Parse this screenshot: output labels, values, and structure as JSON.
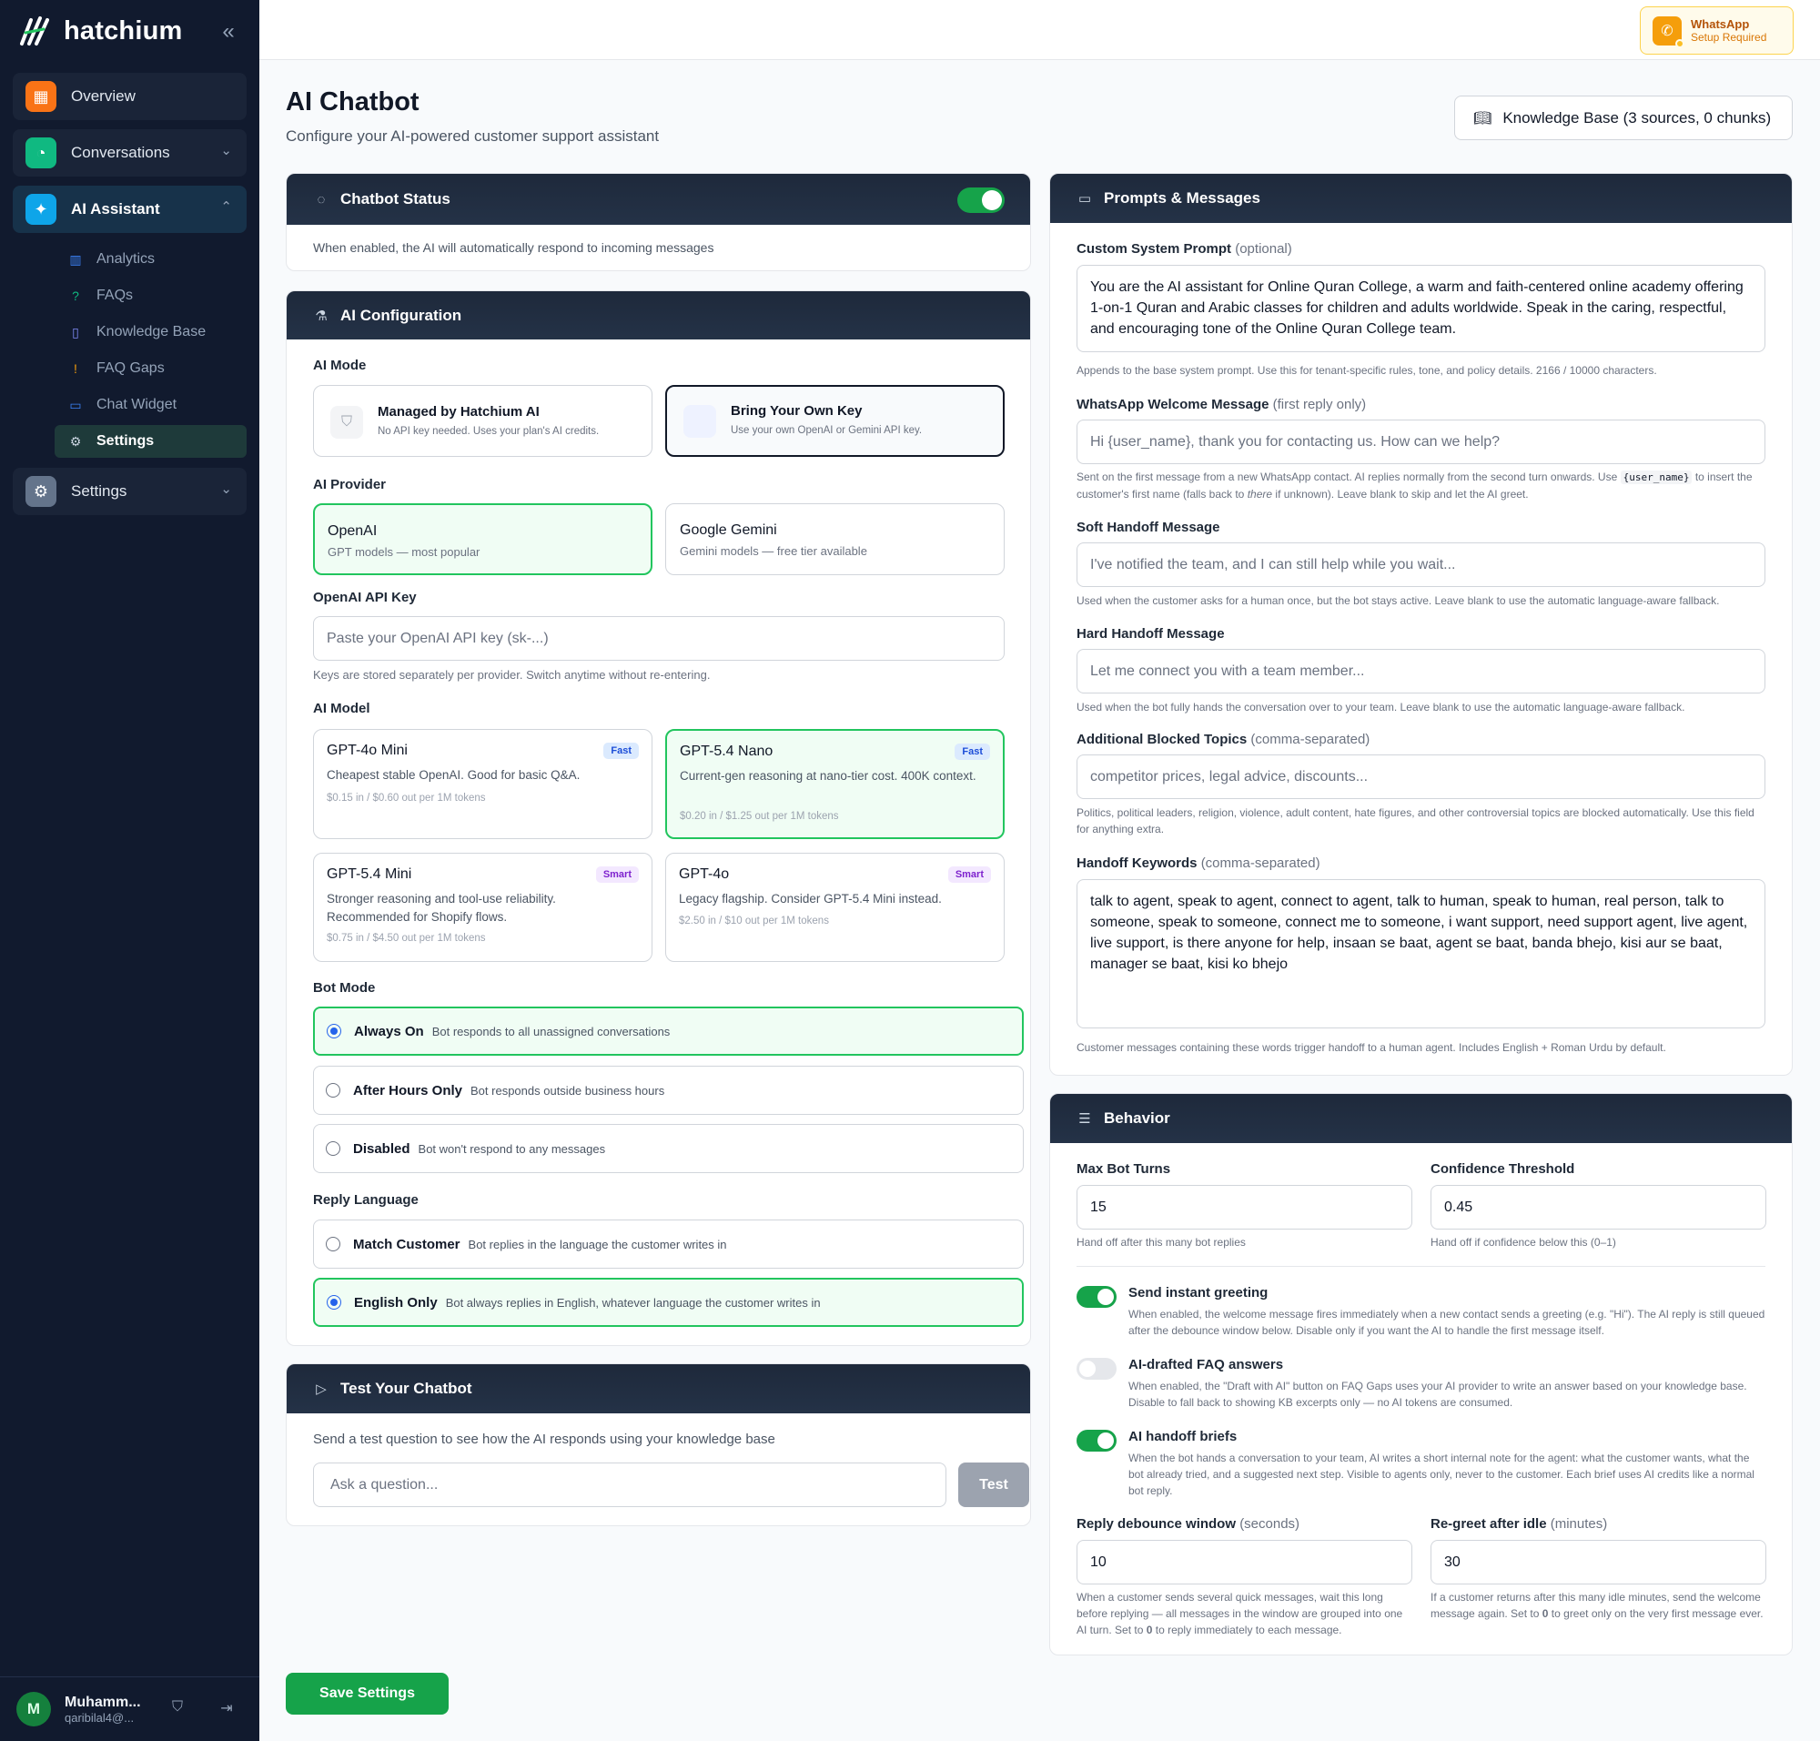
{
  "sidebar": {
    "brand": "hatchium",
    "nav": {
      "overview": "Overview",
      "conversations": "Conversations",
      "ai_assistant": "AI Assistant",
      "settings": "Settings"
    },
    "sub_items": {
      "analytics": "Analytics",
      "faqs": "FAQs",
      "knowledge_base": "Knowledge Base",
      "faq_gaps": "FAQ Gaps",
      "chat_widget": "Chat Widget",
      "settings": "Settings"
    },
    "user": {
      "initial": "M",
      "name": "Muhamm...",
      "email": "qaribilal4@..."
    }
  },
  "topbar": {
    "whatsapp_title": "WhatsApp",
    "whatsapp_sub": "Setup Required"
  },
  "page": {
    "title": "AI Chatbot",
    "subtitle": "Configure your AI-powered customer support assistant",
    "kb_button": "Knowledge Base (3 sources, 0 chunks)"
  },
  "status_card": {
    "title": "Chatbot Status",
    "enabled": true,
    "desc": "When enabled, the AI will automatically respond to incoming messages"
  },
  "config_card": {
    "title": "AI Configuration",
    "ai_mode_label": "AI Mode",
    "ai_modes": [
      {
        "title": "Managed by Hatchium AI",
        "desc": "No API key needed. Uses your plan's AI credits."
      },
      {
        "title": "Bring Your Own Key",
        "desc": "Use your own OpenAI or Gemini API key."
      }
    ],
    "provider_label": "AI Provider",
    "providers": [
      {
        "title": "OpenAI",
        "desc": "GPT models — most popular"
      },
      {
        "title": "Google Gemini",
        "desc": "Gemini models — free tier available"
      }
    ],
    "api_key_label": "OpenAI API Key",
    "api_key_placeholder": "Paste your OpenAI API key (sk-...)",
    "api_key_help": "Keys are stored separately per provider. Switch anytime without re-entering.",
    "model_label": "AI Model",
    "models": [
      {
        "title": "GPT-4o Mini",
        "badge": "Fast",
        "desc": "Cheapest stable OpenAI. Good for basic Q&A.",
        "price": "$0.15 in / $0.60 out per 1M tokens"
      },
      {
        "title": "GPT-5.4 Nano",
        "badge": "Fast",
        "desc": "Current-gen reasoning at nano-tier cost. 400K context.",
        "price": "$0.20 in / $1.25 out per 1M tokens"
      },
      {
        "title": "GPT-5.4 Mini",
        "badge": "Smart",
        "desc": "Stronger reasoning and tool-use reliability. Recommended for Shopify flows.",
        "price": "$0.75 in / $4.50 out per 1M tokens"
      },
      {
        "title": "GPT-4o",
        "badge": "Smart",
        "desc": "Legacy flagship. Consider GPT-5.4 Mini instead.",
        "price": "$2.50 in / $10 out per 1M tokens"
      }
    ],
    "bot_mode_label": "Bot Mode",
    "bot_modes": [
      {
        "title": "Always On",
        "desc": "Bot responds to all unassigned conversations"
      },
      {
        "title": "After Hours Only",
        "desc": "Bot responds outside business hours"
      },
      {
        "title": "Disabled",
        "desc": "Bot won't respond to any messages"
      }
    ],
    "reply_lang_label": "Reply Language",
    "reply_langs": [
      {
        "title": "Match Customer",
        "desc": "Bot replies in the language the customer writes in"
      },
      {
        "title": "English Only",
        "desc": "Bot always replies in English, whatever language the customer writes in"
      }
    ]
  },
  "test_card": {
    "title": "Test Your Chatbot",
    "desc": "Send a test question to see how the AI responds using your knowledge base",
    "placeholder": "Ask a question...",
    "button": "Test"
  },
  "prompts_card": {
    "title": "Prompts & Messages",
    "system_prompt_label": "Custom System Prompt",
    "system_prompt_opt": "(optional)",
    "system_prompt_value": "You are the AI assistant for Online Quran College, a warm and faith-centered online academy offering 1-on-1 Quran and Arabic classes for children and adults worldwide. Speak in the caring, respectful, and encouraging tone of the Online Quran College team.",
    "system_prompt_help": "Appends to the base system prompt. Use this for tenant-specific rules, tone, and policy details. 2166 / 10000 characters.",
    "welcome_label": "WhatsApp Welcome Message",
    "welcome_opt": "(first reply only)",
    "welcome_placeholder": "Hi {user_name}, thank you for contacting us. How can we help?",
    "welcome_help_1": "Sent on the first message from a new WhatsApp contact. AI replies normally from the second turn onwards. Use",
    "welcome_help_code": "{user_name}",
    "welcome_help_2": "to insert the customer's first name (falls back to",
    "welcome_help_em": "there",
    "welcome_help_3": "if unknown). Leave blank to skip and let the AI greet.",
    "soft_label": "Soft Handoff Message",
    "soft_placeholder": "I've notified the team, and I can still help while you wait...",
    "soft_help": "Used when the customer asks for a human once, but the bot stays active. Leave blank to use the automatic language-aware fallback.",
    "hard_label": "Hard Handoff Message",
    "hard_placeholder": "Let me connect you with a team member...",
    "hard_help": "Used when the bot fully hands the conversation over to your team. Leave blank to use the automatic language-aware fallback.",
    "blocked_label": "Additional Blocked Topics",
    "blocked_opt": "(comma-separated)",
    "blocked_placeholder": "competitor prices, legal advice, discounts...",
    "blocked_help": "Politics, political leaders, religion, violence, adult content, hate figures, and other controversial topics are blocked automatically. Use this field for anything extra.",
    "keywords_label": "Handoff Keywords",
    "keywords_opt": "(comma-separated)",
    "keywords_value": "talk to agent, speak to agent, connect to agent, talk to human, speak to human, real person, talk to someone, speak to someone, connect me to someone, i want support, need support agent, live agent, live support, is there anyone for help, insaan se baat, agent se baat, banda bhejo, kisi aur se baat, manager se baat, kisi ko bhejo",
    "keywords_help": "Customer messages containing these words trigger handoff to a human agent. Includes English + Roman Urdu by default."
  },
  "behavior_card": {
    "title": "Behavior",
    "max_turns_label": "Max Bot Turns",
    "max_turns_value": "15",
    "max_turns_help": "Hand off after this many bot replies",
    "confidence_label": "Confidence Threshold",
    "confidence_value": "0.45",
    "confidence_help": "Hand off if confidence below this (0–1)",
    "toggles": [
      {
        "title": "Send instant greeting",
        "on": true,
        "desc": "When enabled, the welcome message fires immediately when a new contact sends a greeting (e.g. \"Hi\"). The AI reply is still queued after the debounce window below. Disable only if you want the AI to handle the first message itself."
      },
      {
        "title": "AI-drafted FAQ answers",
        "on": false,
        "desc": "When enabled, the \"Draft with AI\" button on FAQ Gaps uses your AI provider to write an answer based on your knowledge base. Disable to fall back to showing KB excerpts only — no AI tokens are consumed."
      },
      {
        "title": "AI handoff briefs",
        "on": true,
        "desc": "When the bot hands a conversation to your team, AI writes a short internal note for the agent: what the customer wants, what the bot already tried, and a suggested next step. Visible to agents only, never to the customer. Each brief uses AI credits like a normal bot reply."
      }
    ],
    "debounce_label": "Reply debounce window",
    "debounce_opt": "(seconds)",
    "debounce_value": "10",
    "debounce_help_1": "When a customer sends several quick messages, wait this long before replying — all messages in the window are grouped into one AI turn. Set to",
    "debounce_help_b": "0",
    "debounce_help_2": "to reply immediately to each message.",
    "regreet_label": "Re-greet after idle",
    "regreet_opt": "(minutes)",
    "regreet_value": "30",
    "regreet_help_1": "If a customer returns after this many idle minutes, send the welcome message again. Set to",
    "regreet_help_b": "0",
    "regreet_help_2": "to greet only on the very first message ever."
  },
  "save_button": "Save Settings"
}
